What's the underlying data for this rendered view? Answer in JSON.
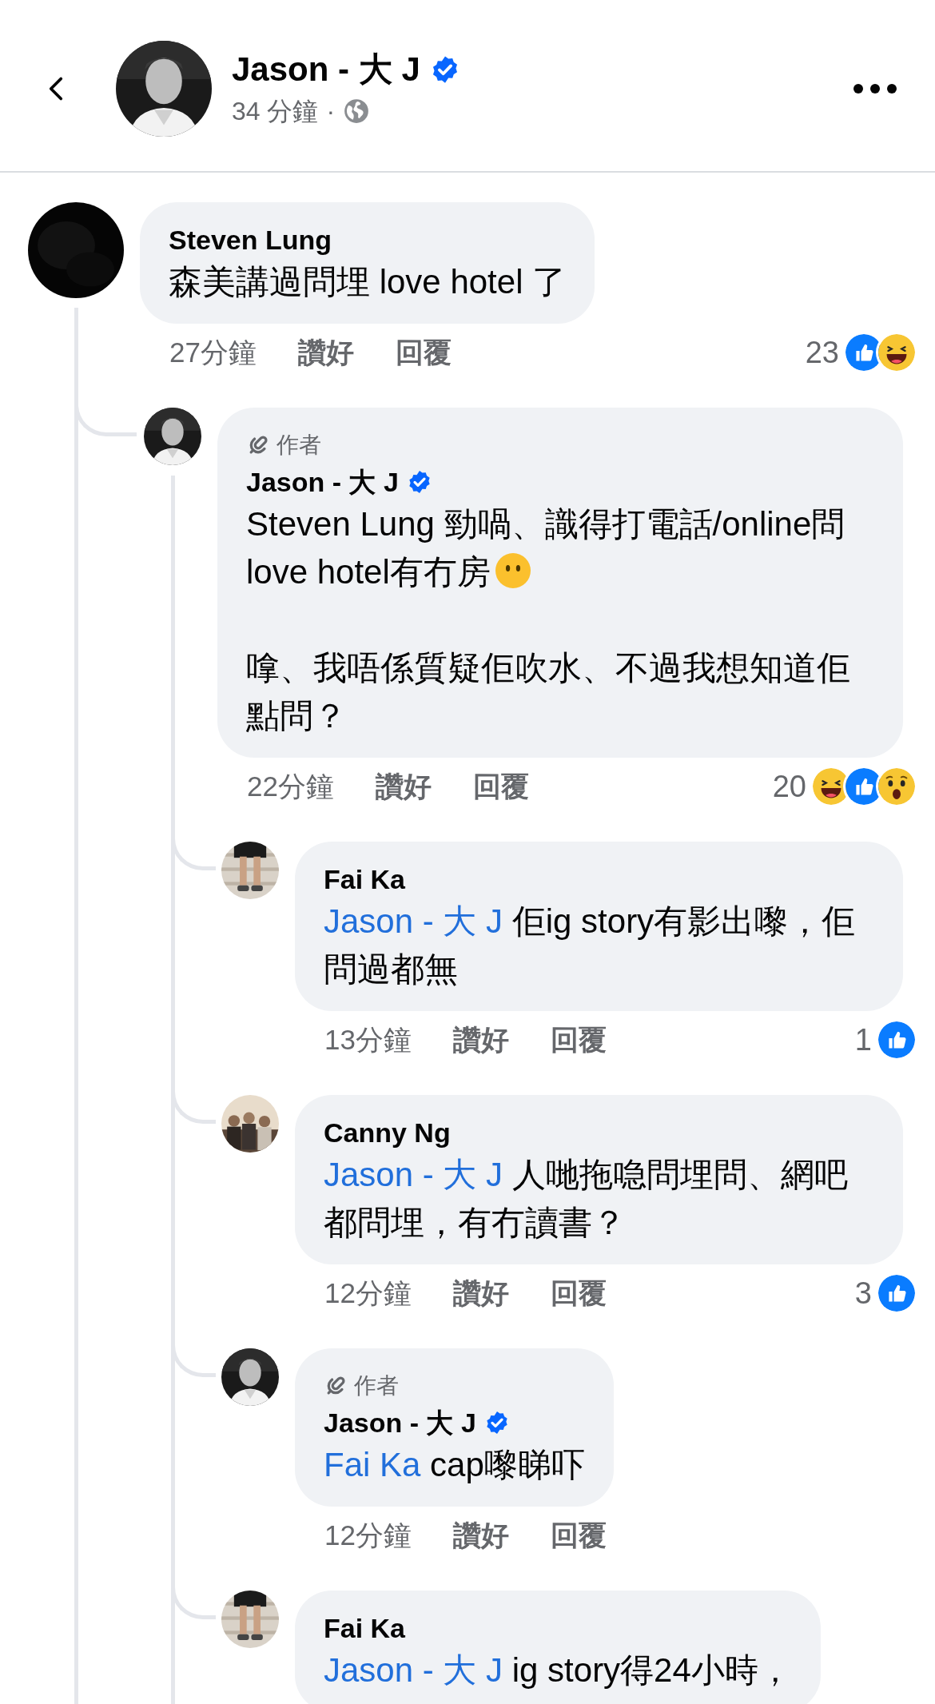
{
  "header": {
    "title": "Jason - 大 J",
    "verified": true,
    "time": "34 分鐘",
    "separator": "·"
  },
  "comments": [
    {
      "author": "Steven Lung",
      "paragraphs": [
        {
          "text": "森美講過問埋 love hotel 了"
        }
      ],
      "time": "27分鐘",
      "like_label": "讚好",
      "reply_label": "回覆",
      "reaction_count": "23",
      "reactions": [
        {
          "kind": "like"
        },
        {
          "kind": "haha"
        }
      ],
      "children": [
        {
          "author": "Jason - 大 J",
          "author_badge": "作者",
          "verified": true,
          "paragraphs": [
            {
              "text": "Steven Lung 勁喎、識得打電話/online問 love hotel有冇房",
              "emoji_after": true
            },
            {
              "text": "嗱、我唔係質疑佢吹水、不過我想知道佢點問？"
            }
          ],
          "time": "22分鐘",
          "like_label": "讚好",
          "reply_label": "回覆",
          "reaction_count": "20",
          "reactions": [
            {
              "kind": "haha"
            },
            {
              "kind": "like"
            },
            {
              "kind": "wow"
            }
          ],
          "children": [
            {
              "author": "Fai Ka",
              "paragraphs": [
                {
                  "mention": "Jason - 大 J",
                  "text": "佢ig story有影出嚟，佢問過都無"
                }
              ],
              "time": "13分鐘",
              "like_label": "讚好",
              "reply_label": "回覆",
              "reaction_count": "1",
              "reactions": [
                {
                  "kind": "like"
                }
              ]
            },
            {
              "author": "Canny Ng",
              "paragraphs": [
                {
                  "mention": "Jason - 大 J",
                  "text": "人哋拖喼問埋問、網吧都問埋，有冇讀書？"
                }
              ],
              "time": "12分鐘",
              "like_label": "讚好",
              "reply_label": "回覆",
              "reaction_count": "3",
              "reactions": [
                {
                  "kind": "like"
                }
              ]
            },
            {
              "author": "Jason - 大 J",
              "author_badge": "作者",
              "verified": true,
              "paragraphs": [
                {
                  "mention": "Fai Ka",
                  "text": "cap嚟睇吓"
                }
              ],
              "time": "12分鐘",
              "like_label": "讚好",
              "reply_label": "回覆"
            },
            {
              "author": "Fai Ka",
              "paragraphs": [
                {
                  "mention": "Jason - 大 J",
                  "text": "ig story得24小時，"
                }
              ]
            }
          ]
        }
      ]
    }
  ]
}
